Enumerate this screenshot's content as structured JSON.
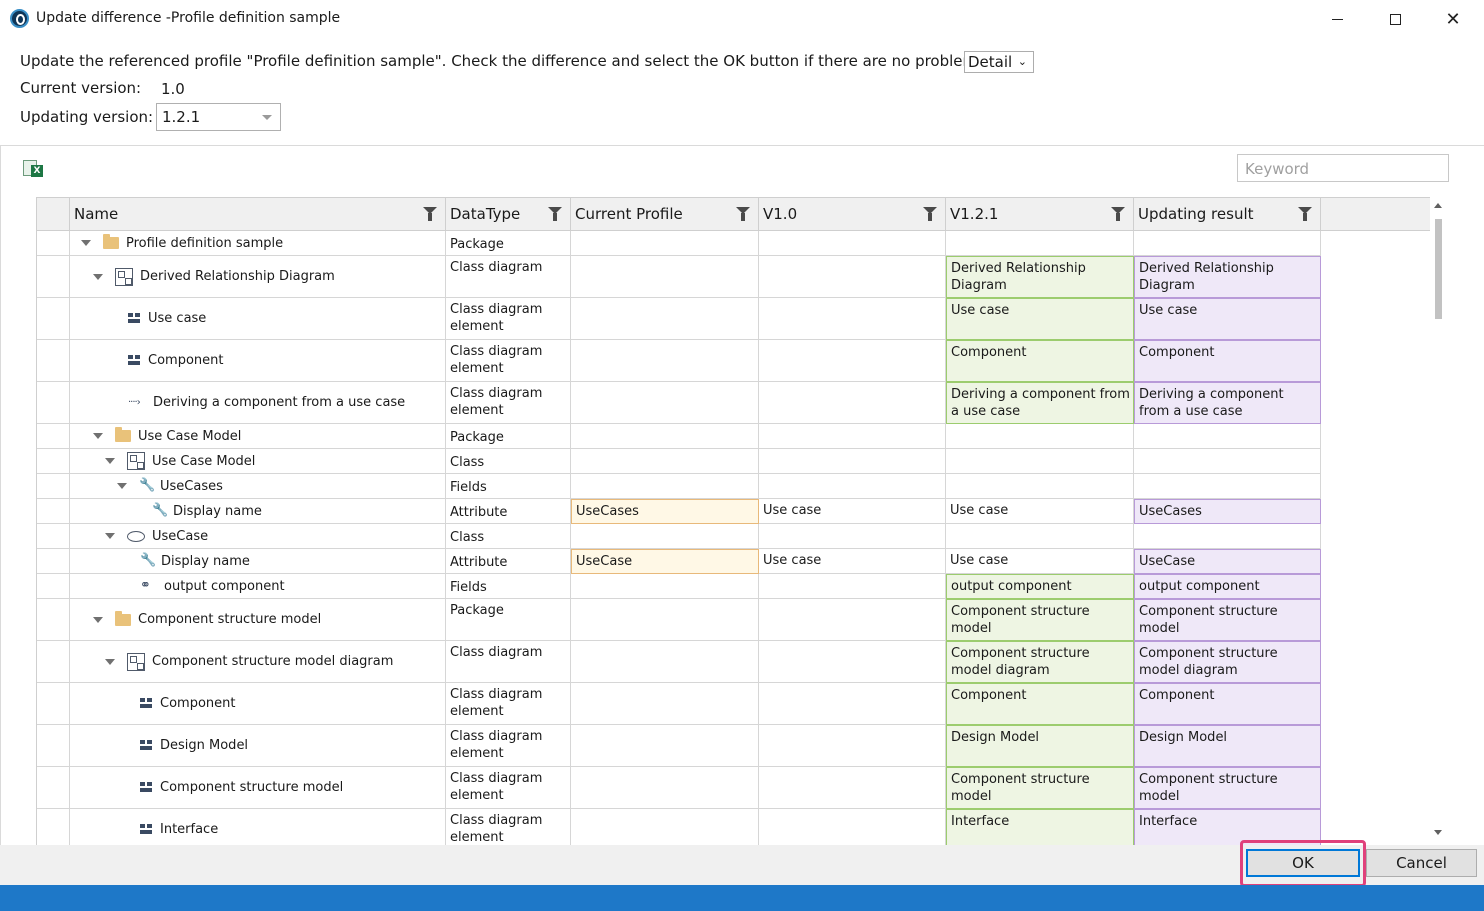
{
  "window": {
    "title": "Update difference -Profile definition sample",
    "min_icon": "minimize-icon",
    "max_icon": "maximize-icon",
    "close_icon": "close-icon",
    "close_glyph": "✕"
  },
  "info": {
    "message": "Update the referenced profile \"Profile definition sample\". Check the difference and select the OK button if there are no problems.",
    "view_mode": "Detail",
    "current_version_label": "Current version:",
    "current_version_value": "1.0",
    "updating_version_label": "Updating version:",
    "updating_version_value": "1.2.1"
  },
  "toolbar": {
    "export_icon": "excel-export-icon",
    "keyword_placeholder": "Keyword"
  },
  "columns": [
    "Name",
    "DataType",
    "Current Profile",
    "V1.0",
    "V1.2.1",
    "Updating result"
  ],
  "rows": [
    {
      "level": 0,
      "expand": "open",
      "icon": "folder",
      "name": "Profile definition sample",
      "type": "Package",
      "cur": "",
      "v10": "",
      "v121": "",
      "res": "",
      "tall": false,
      "hl": []
    },
    {
      "level": 1,
      "expand": "open",
      "icon": "diagram",
      "name": "Derived Relationship Diagram",
      "type": "Class diagram",
      "cur": "",
      "v10": "",
      "v121": "Derived Relationship Diagram",
      "res": "Derived Relationship Diagram",
      "tall": true,
      "hl": [
        "v121",
        "res"
      ]
    },
    {
      "level": 2,
      "expand": "none",
      "icon": "elem",
      "name": "Use case",
      "type": "Class diagram element",
      "cur": "",
      "v10": "",
      "v121": "Use case",
      "res": "Use case",
      "tall": true,
      "hl": [
        "v121",
        "res"
      ]
    },
    {
      "level": 2,
      "expand": "none",
      "icon": "elem",
      "name": "Component",
      "type": "Class diagram element",
      "cur": "",
      "v10": "",
      "v121": "Component",
      "res": "Component",
      "tall": true,
      "hl": [
        "v121",
        "res"
      ]
    },
    {
      "level": 2,
      "expand": "none",
      "icon": "dots",
      "name": "Deriving a component from a use case",
      "type": "Class diagram element",
      "cur": "",
      "v10": "",
      "v121": "Deriving a component from a use case",
      "res": "Deriving a component from a use case",
      "tall": true,
      "hl": [
        "v121",
        "res"
      ]
    },
    {
      "level": 1,
      "expand": "open",
      "icon": "folder",
      "name": "Use Case Model",
      "type": "Package",
      "cur": "",
      "v10": "",
      "v121": "",
      "res": "",
      "tall": false,
      "hl": []
    },
    {
      "level": 2,
      "expand": "open",
      "icon": "diagram",
      "name": "Use Case Model",
      "type": "Class",
      "cur": "",
      "v10": "",
      "v121": "",
      "res": "",
      "tall": false,
      "hl": []
    },
    {
      "level": 3,
      "expand": "open",
      "icon": "wrench",
      "name": "UseCases",
      "type": "Fields",
      "cur": "",
      "v10": "",
      "v121": "",
      "res": "",
      "tall": false,
      "hl": []
    },
    {
      "level": 4,
      "expand": "none",
      "icon": "wrench-blue",
      "name": "Display name",
      "type": "Attribute",
      "cur": "UseCases",
      "v10": "Use case",
      "v121": "Use case",
      "res": "UseCases",
      "tall": false,
      "hl": [
        "cur",
        "res"
      ]
    },
    {
      "level": 2,
      "expand": "open",
      "icon": "ellipse",
      "name": "UseCase",
      "type": "Class",
      "cur": "",
      "v10": "",
      "v121": "",
      "res": "",
      "tall": false,
      "hl": []
    },
    {
      "level": 3,
      "expand": "none",
      "icon": "wrench-blue",
      "name": "Display name",
      "type": "Attribute",
      "cur": "UseCase",
      "v10": "Use case",
      "v121": "Use case",
      "res": "UseCase",
      "tall": false,
      "hl": [
        "cur",
        "res"
      ]
    },
    {
      "level": 3,
      "expand": "none",
      "icon": "link",
      "name": "output component",
      "type": "Fields",
      "cur": "",
      "v10": "",
      "v121": "output component",
      "res": "output component",
      "tall": false,
      "hl": [
        "v121",
        "res"
      ]
    },
    {
      "level": 1,
      "expand": "open",
      "icon": "folder",
      "name": "Component structure model",
      "type": "Package",
      "cur": "",
      "v10": "",
      "v121": " Component structure model",
      "res": " Component structure model",
      "tall": true,
      "hl": [
        "v121",
        "res"
      ]
    },
    {
      "level": 2,
      "expand": "open",
      "icon": "diagram",
      "name": "Component structure model diagram",
      "type": "Class diagram",
      "cur": "",
      "v10": "",
      "v121": "Component structure model diagram",
      "res": "Component structure model diagram",
      "tall": true,
      "hl": [
        "v121",
        "res"
      ]
    },
    {
      "level": 3,
      "expand": "none",
      "icon": "elem",
      "name": "Component",
      "type": "Class diagram element",
      "cur": "",
      "v10": "",
      "v121": "Component",
      "res": "Component",
      "tall": true,
      "hl": [
        "v121",
        "res"
      ]
    },
    {
      "level": 3,
      "expand": "none",
      "icon": "elem",
      "name": "Design Model",
      "type": "Class diagram element",
      "cur": "",
      "v10": "",
      "v121": "Design Model",
      "res": "Design Model",
      "tall": true,
      "hl": [
        "v121",
        "res"
      ]
    },
    {
      "level": 3,
      "expand": "none",
      "icon": "elem",
      "name": " Component structure model",
      "type": "Class diagram element",
      "cur": "",
      "v10": "",
      "v121": " Component structure model",
      "res": " Component structure model",
      "tall": true,
      "hl": [
        "v121",
        "res"
      ]
    },
    {
      "level": 3,
      "expand": "none",
      "icon": "elem",
      "name": "Interface",
      "type": "Class diagram element",
      "cur": "",
      "v10": "",
      "v121": "Interface",
      "res": "Interface",
      "tall": true,
      "hl": [
        "v121",
        "res"
      ]
    }
  ],
  "buttons": {
    "ok": "OK",
    "cancel": "Cancel"
  },
  "colors": {
    "current_highlight": "#fff8e6",
    "v121_highlight": "#eef5e3",
    "result_highlight": "#efe8f8",
    "ok_callout": "#e0417b",
    "statusbar": "#1e78c8"
  }
}
